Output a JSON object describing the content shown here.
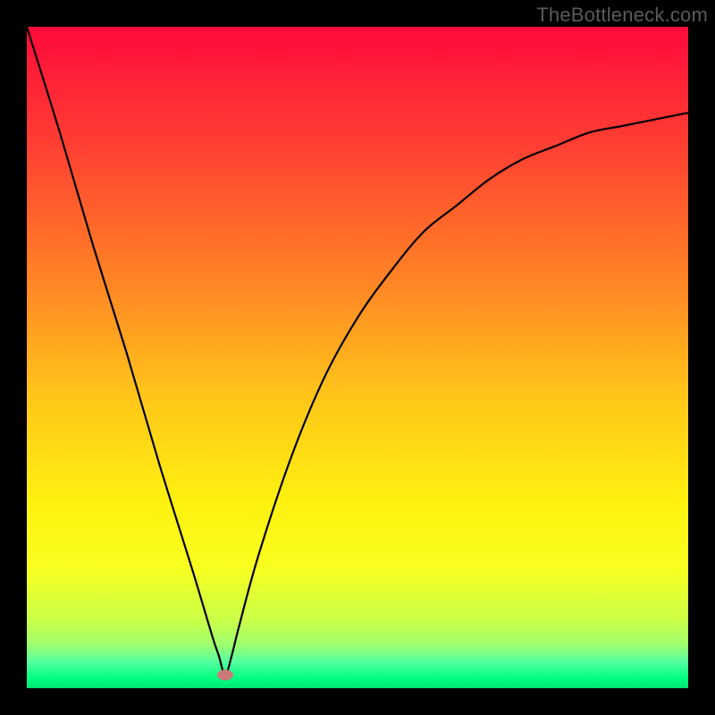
{
  "watermark": "TheBottleneck.com",
  "chart_data": {
    "type": "line",
    "title": "",
    "xlabel": "",
    "ylabel": "",
    "xlim": [
      0,
      100
    ],
    "ylim": [
      0,
      100
    ],
    "grid": false,
    "legend": false,
    "background_gradient": {
      "stops": [
        {
          "pos": 0.0,
          "color": "#ff0a3a"
        },
        {
          "pos": 0.18,
          "color": "#ff3f32"
        },
        {
          "pos": 0.4,
          "color": "#ff8a24"
        },
        {
          "pos": 0.55,
          "color": "#ffc31a"
        },
        {
          "pos": 0.72,
          "color": "#fff110"
        },
        {
          "pos": 0.82,
          "color": "#f8ff20"
        },
        {
          "pos": 0.9,
          "color": "#c8ff4a"
        },
        {
          "pos": 0.935,
          "color": "#9dff70"
        },
        {
          "pos": 0.96,
          "color": "#55ffa0"
        },
        {
          "pos": 0.985,
          "color": "#00ff7f"
        },
        {
          "pos": 1.0,
          "color": "#00e676"
        }
      ]
    },
    "marker": {
      "x": 30,
      "y": 2,
      "color": "#c97a78"
    },
    "series": [
      {
        "name": "curve",
        "color": "#000000",
        "x": [
          0,
          5,
          10,
          15,
          20,
          25,
          28,
          29,
          30,
          31,
          32,
          35,
          40,
          45,
          50,
          55,
          60,
          65,
          70,
          75,
          80,
          85,
          90,
          95,
          100
        ],
        "values": [
          100,
          84,
          67,
          51,
          34,
          18,
          8,
          5,
          2,
          5,
          9,
          20,
          35,
          47,
          56,
          63,
          69,
          73,
          77,
          80,
          82,
          84,
          85,
          86,
          87
        ]
      }
    ]
  }
}
